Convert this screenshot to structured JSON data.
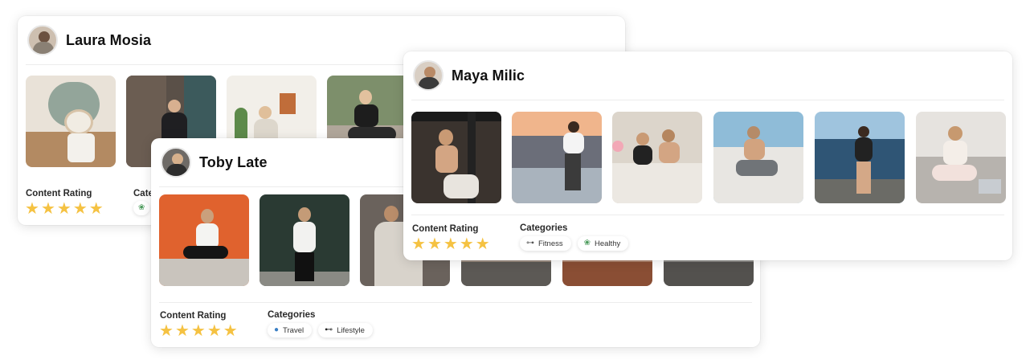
{
  "cards": {
    "laura": {
      "name": "Laura Mosia",
      "rating_label": "Content Rating",
      "rating": 5,
      "categories_label": "Cate"
    },
    "toby": {
      "name": "Toby Late",
      "rating_label": "Content Rating",
      "rating": 5,
      "categories_label": "Categories",
      "categories": [
        {
          "label": "Travel",
          "icon": "globe-icon"
        },
        {
          "label": "Lifestyle",
          "icon": "sunglasses-icon"
        }
      ]
    },
    "maya": {
      "name": "Maya Milic",
      "rating_label": "Content Rating",
      "rating": 5,
      "categories_label": "Categories",
      "categories": [
        {
          "label": "Fitness",
          "icon": "dumbbell-icon"
        },
        {
          "label": "Healthy",
          "icon": "lotus-icon"
        }
      ]
    }
  },
  "colors": {
    "star": "#f5c242"
  }
}
